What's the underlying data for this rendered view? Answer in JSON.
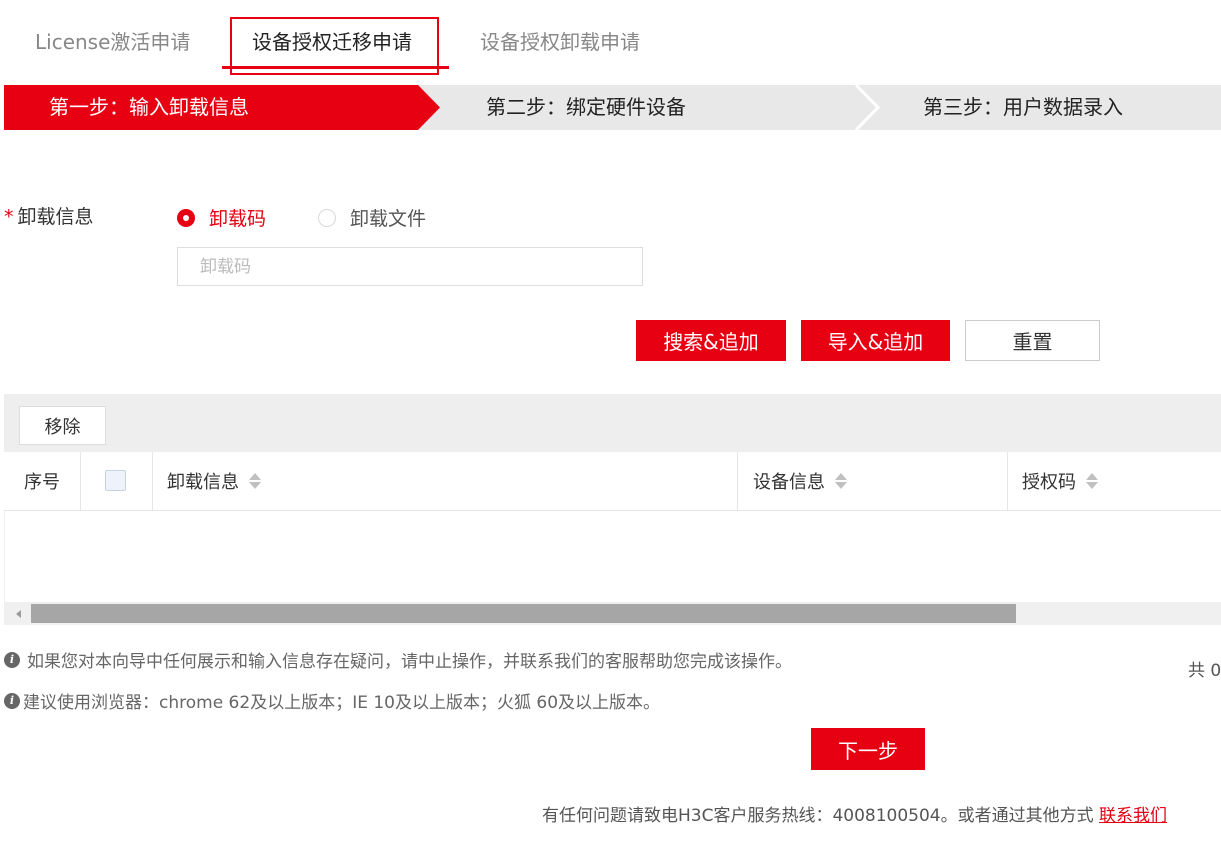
{
  "tabs": [
    {
      "label": "License激活申请"
    },
    {
      "label": "设备授权迁移申请"
    },
    {
      "label": "设备授权卸载申请"
    }
  ],
  "steps": [
    {
      "label": "第一步：输入卸载信息"
    },
    {
      "label": "第二步：绑定硬件设备"
    },
    {
      "label": "第三步：用户数据录入"
    }
  ],
  "form": {
    "required_mark": "*",
    "label": "卸载信息",
    "radio_code": "卸载码",
    "radio_file": "卸载文件",
    "input_placeholder": "卸载码",
    "input_value": ""
  },
  "buttons": {
    "search_add": "搜索&追加",
    "import_add": "导入&追加",
    "reset": "重置",
    "remove": "移除",
    "next": "下一步"
  },
  "table": {
    "columns": [
      "序号",
      "卸载信息",
      "设备信息",
      "授权码"
    ],
    "rows": []
  },
  "notes": {
    "note1": "如果您对本向导中任何展示和输入信息存在疑问，请中止操作，并联系我们的客服帮助您完成该操作。",
    "note2": "建议使用浏览器：chrome 62及以上版本；IE 10及以上版本；火狐 60及以上版本。",
    "total": "共 0"
  },
  "footer": {
    "text": "有任何问题请致电H3C客户服务热线：4008100504。或者通过其他方式",
    "link": "联系我们"
  },
  "colors": {
    "accent": "#e60012",
    "step_inactive_bg": "#e8e8e8"
  },
  "icons": [
    "info-icon",
    "sort-icon",
    "scroll-left-arrow-icon"
  ]
}
